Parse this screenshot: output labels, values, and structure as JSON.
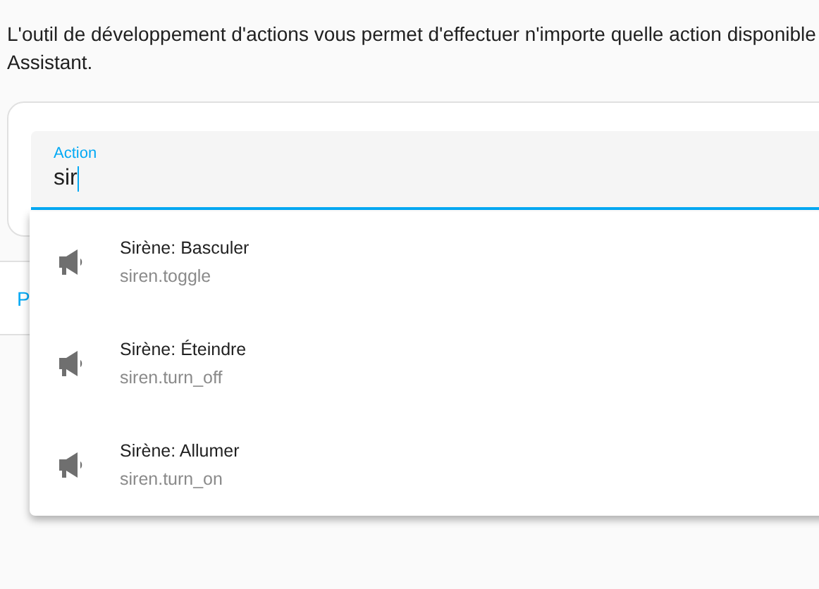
{
  "description_lines": [
    "L'outil de développement d'actions vous permet d'effectuer n'importe quelle action disponible",
    "Assistant."
  ],
  "action_field": {
    "label": "Action",
    "value": "sir",
    "focused": true
  },
  "section_text": "P",
  "suggestions": [
    {
      "title": "Sirène: Basculer",
      "subtitle": "siren.toggle"
    },
    {
      "title": "Sirène: Éteindre",
      "subtitle": "siren.turn_off"
    },
    {
      "title": "Sirène: Allumer",
      "subtitle": "siren.turn_on"
    }
  ]
}
